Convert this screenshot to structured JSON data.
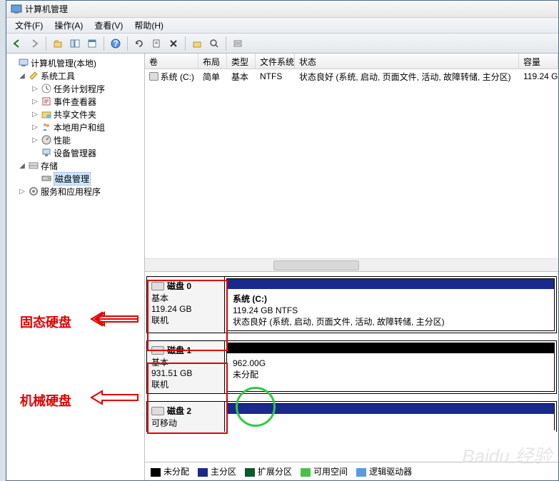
{
  "window": {
    "title": "计算机管理"
  },
  "menu": {
    "file": "文件(F)",
    "action": "操作(A)",
    "view": "查看(V)",
    "help": "帮助(H)"
  },
  "tree": {
    "root": "计算机管理(本地)",
    "systools": "系统工具",
    "taskscheduler": "任务计划程序",
    "eventviewer": "事件查看器",
    "sharedfolders": "共享文件夹",
    "localusers": "本地用户和组",
    "performance": "性能",
    "devicemgr": "设备管理器",
    "storage": "存储",
    "diskmgmt": "磁盘管理",
    "services": "服务和应用程序"
  },
  "columns": {
    "volume": "卷",
    "layout": "布局",
    "type": "类型",
    "fs": "文件系统",
    "status": "状态",
    "capacity": "容量"
  },
  "volumes": [
    {
      "name": "系统 (C:)",
      "layout": "简单",
      "type": "基本",
      "fs": "NTFS",
      "status": "状态良好 (系统, 启动, 页面文件, 活动, 故障转储, 主分区)",
      "capacity": "119.24 G"
    }
  ],
  "disks": [
    {
      "title": "磁盘 0",
      "kind": "基本",
      "size": "119.24 GB",
      "state": "联机",
      "part": {
        "name": "系统  (C:)",
        "size": "119.24 GB NTFS",
        "status": "状态良好 (系统, 启动, 页面文件, 活动, 故障转储, 主分区)",
        "stripe": "#1a2a8c"
      }
    },
    {
      "title": "磁盘 1",
      "kind": "基本",
      "size": "931.51 GB",
      "state": "联机",
      "part": {
        "name": "",
        "size": "962.00G",
        "status": "未分配",
        "stripe": "#000000"
      }
    },
    {
      "title": "磁盘 2",
      "kind": "可移动",
      "size": "",
      "state": "",
      "part": null
    }
  ],
  "legend": {
    "unalloc": "未分配",
    "primary": "主分区",
    "extended": "扩展分区",
    "free": "可用空间",
    "logical": "逻辑驱动器"
  },
  "annotations": {
    "ssd": "固态硬盘",
    "hdd": "机械硬盘"
  },
  "watermark": "Baidu 经验"
}
